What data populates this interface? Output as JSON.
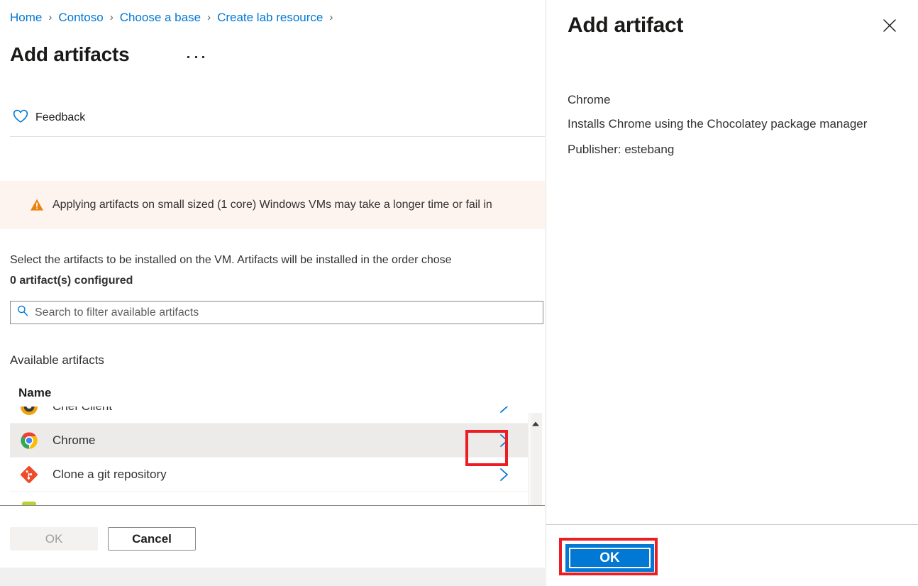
{
  "breadcrumb": {
    "name": "breadcrumb",
    "separator": "›",
    "items": [
      {
        "label": "Home"
      },
      {
        "label": "Contoso"
      },
      {
        "label": "Choose a base"
      },
      {
        "label": "Create lab resource"
      }
    ],
    "trailing_separator": "›"
  },
  "page": {
    "title": "Add artifacts",
    "more_menu": "context-menu-ellipsis"
  },
  "command_bar": {
    "feedback_label": "Feedback",
    "feedback_icon": "heart-icon"
  },
  "warning": {
    "icon": "warning-triangle-icon",
    "text": "Applying artifacts on small sized (1 core) Windows VMs may take a longer time or fail in",
    "background": "#fdf3ef",
    "icon_color": "#e8820c"
  },
  "description": {
    "text": "Select the artifacts to be installed on the VM. Artifacts will be installed in the order chose",
    "configured_count": "0 artifact(s) configured"
  },
  "search": {
    "icon": "search-icon",
    "value": "",
    "placeholder": "Search to filter available artifacts"
  },
  "artifacts_section": {
    "label": "Available artifacts",
    "column_header_name": "Name",
    "chevron_icon": "chevron-right-icon",
    "scrollbar_up_icon": "caret-up-icon",
    "rows": [
      {
        "name": "Chef Client",
        "icon": "chef-client-icon",
        "selected": false
      },
      {
        "name": "Chrome",
        "icon": "chrome-icon",
        "selected": true
      },
      {
        "name": "Clone a git repository",
        "icon": "git-icon",
        "selected": false
      },
      {
        "name": "",
        "icon": "partial-icon",
        "selected": false
      }
    ]
  },
  "footer": {
    "ok_label": "OK",
    "cancel_label": "Cancel"
  },
  "side_panel": {
    "title": "Add artifact",
    "close_icon": "close-icon",
    "artifact_name": "Chrome",
    "artifact_description": "Installs Chrome using the Chocolatey package manager",
    "artifact_publisher": "Publisher: estebang",
    "ok_label": "OK"
  },
  "colors": {
    "accent_blue": "#0078d4",
    "link_blue": "#0078d4",
    "annotation_red": "#ec1c24",
    "warning_orange": "#e8820c",
    "selected_row": "#edebe9",
    "disabled_text": "#a19f9d"
  }
}
